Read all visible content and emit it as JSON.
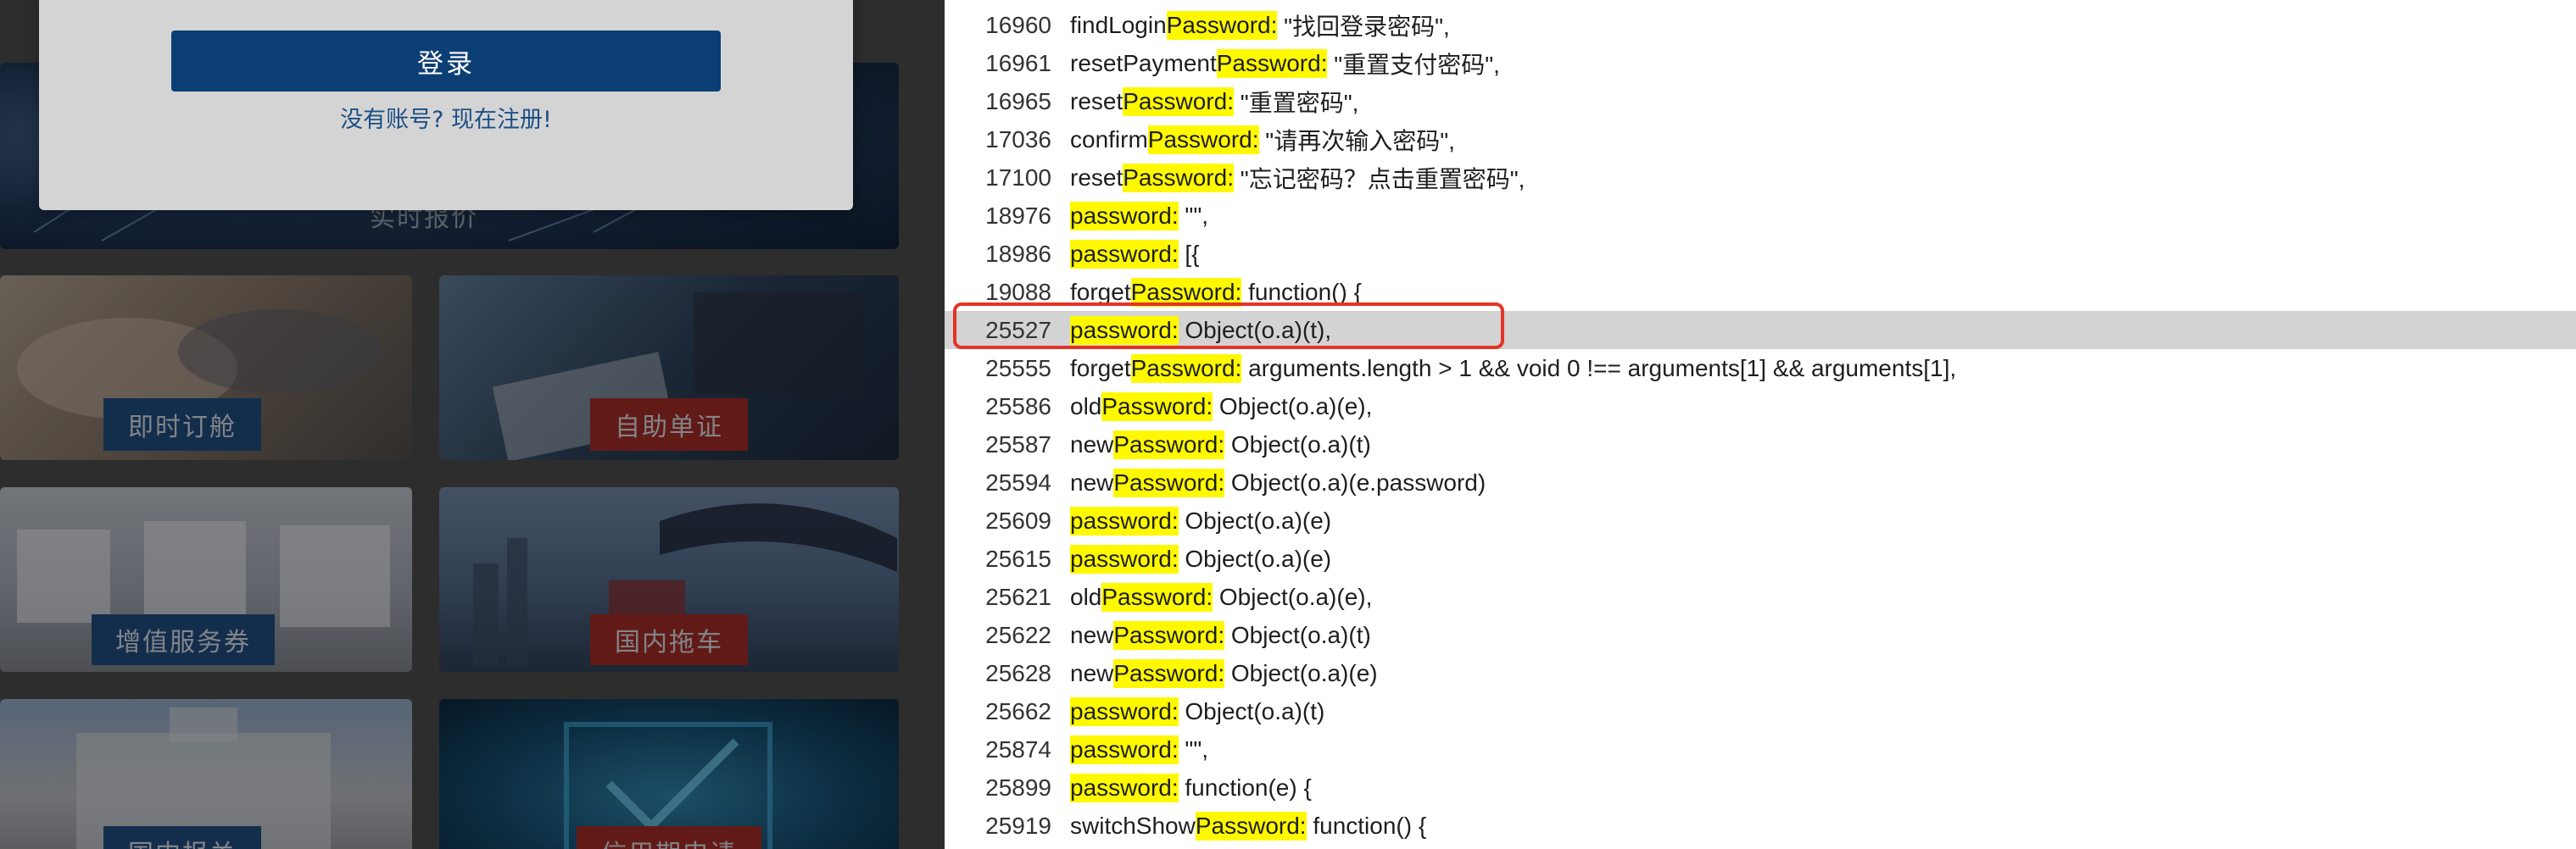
{
  "login_modal": {
    "login_button_label": "登录",
    "register_link_text": "没有账号? 现在注册!"
  },
  "tiles": {
    "realtime_quote": "实时报价",
    "instant_booking": "即时订舱",
    "self_service_docs": "自助单证",
    "value_added_coupon": "增值服务券",
    "domestic_trucking": "国内拖车",
    "customs_declaration": "国内报关",
    "credit_term_apply": "信用期申请"
  },
  "search_results": [
    {
      "line": "16960",
      "prefix": "findLogin",
      "match": "Password:",
      "rest": " \"找回登录密码\","
    },
    {
      "line": "16961",
      "prefix": "resetPayment",
      "match": "Password:",
      "rest": " \"重置支付密码\","
    },
    {
      "line": "16965",
      "prefix": "reset",
      "match": "Password:",
      "rest": " \"重置密码\","
    },
    {
      "line": "17036",
      "prefix": "confirm",
      "match": "Password:",
      "rest": " \"请再次输入密码\","
    },
    {
      "line": "17100",
      "prefix": "reset",
      "match": "Password:",
      "rest": " \"忘记密码？点击重置密码\","
    },
    {
      "line": "18976",
      "prefix": "",
      "match": "password:",
      "rest": " \"\","
    },
    {
      "line": "18986",
      "prefix": "",
      "match": "password:",
      "rest": " [{"
    },
    {
      "line": "19088",
      "prefix": "forget",
      "match": "Password:",
      "rest": " function() {"
    },
    {
      "line": "25527",
      "prefix": "",
      "match": "password:",
      "rest": " Object(o.a)(t),"
    },
    {
      "line": "25555",
      "prefix": "forget",
      "match": "Password:",
      "rest": " arguments.length > 1 && void 0 !== arguments[1] && arguments[1],"
    },
    {
      "line": "25586",
      "prefix": "old",
      "match": "Password:",
      "rest": " Object(o.a)(e),"
    },
    {
      "line": "25587",
      "prefix": "new",
      "match": "Password:",
      "rest": " Object(o.a)(t)"
    },
    {
      "line": "25594",
      "prefix": "new",
      "match": "Password:",
      "rest": " Object(o.a)(e.password)"
    },
    {
      "line": "25609",
      "prefix": "",
      "match": "password:",
      "rest": " Object(o.a)(e)"
    },
    {
      "line": "25615",
      "prefix": "",
      "match": "password:",
      "rest": " Object(o.a)(e)"
    },
    {
      "line": "25621",
      "prefix": "old",
      "match": "Password:",
      "rest": " Object(o.a)(e),"
    },
    {
      "line": "25622",
      "prefix": "new",
      "match": "Password:",
      "rest": " Object(o.a)(t)"
    },
    {
      "line": "25628",
      "prefix": "new",
      "match": "Password:",
      "rest": " Object(o.a)(e)"
    },
    {
      "line": "25662",
      "prefix": "",
      "match": "password:",
      "rest": " Object(o.a)(t)"
    },
    {
      "line": "25874",
      "prefix": "",
      "match": "password:",
      "rest": " \"\","
    },
    {
      "line": "25899",
      "prefix": "",
      "match": "password:",
      "rest": " function(e) {"
    },
    {
      "line": "25919",
      "prefix": "switchShow",
      "match": "Password:",
      "rest": " function() {"
    }
  ],
  "selected_line": "25527",
  "colors": {
    "highlight": "#fff900",
    "selected_row": "#d3d3d3",
    "selection_outline": "#e53325",
    "login_button": "#0b3e74"
  }
}
